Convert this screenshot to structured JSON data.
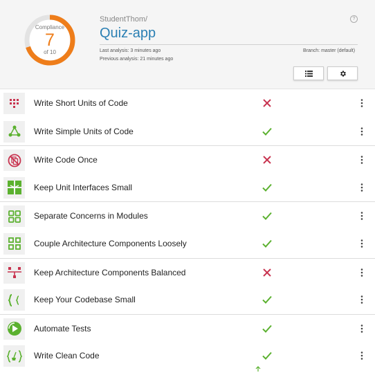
{
  "header": {
    "compliance_label": "Compliance",
    "score": "7",
    "of_total": "of 10",
    "owner": "StudentThom/",
    "repo": "Quiz-app",
    "last_analysis": "Last analysis: 3 minutes ago",
    "previous_analysis": "Previous analysis: 21 minutes ago",
    "branch": "Branch: master (default)",
    "help_glyph": "?",
    "compliance_fraction": 0.7
  },
  "colors": {
    "accent": "#ee7d1a",
    "link": "#2a7fb3",
    "pass": "#5bb12f",
    "fail": "#c8334f"
  },
  "guidelines": [
    {
      "label": "Write Short Units of Code",
      "status": "fail",
      "icon": "short-units-icon"
    },
    {
      "label": "Write Simple Units of Code",
      "status": "pass",
      "icon": "simple-units-icon"
    },
    {
      "label": "Write Code Once",
      "status": "fail",
      "icon": "code-once-icon"
    },
    {
      "label": "Keep Unit Interfaces Small",
      "status": "pass",
      "icon": "unit-interfaces-icon"
    },
    {
      "label": "Separate Concerns in Modules",
      "status": "pass",
      "icon": "modules-icon"
    },
    {
      "label": "Couple Architecture Components Loosely",
      "status": "pass",
      "icon": "couple-components-icon"
    },
    {
      "label": "Keep Architecture Components Balanced",
      "status": "fail",
      "icon": "balanced-components-icon"
    },
    {
      "label": "Keep Your Codebase Small",
      "status": "pass",
      "icon": "codebase-small-icon"
    },
    {
      "label": "Automate Tests",
      "status": "pass",
      "icon": "automate-tests-icon"
    },
    {
      "label": "Write Clean Code",
      "status": "pass",
      "icon": "clean-code-icon"
    }
  ]
}
